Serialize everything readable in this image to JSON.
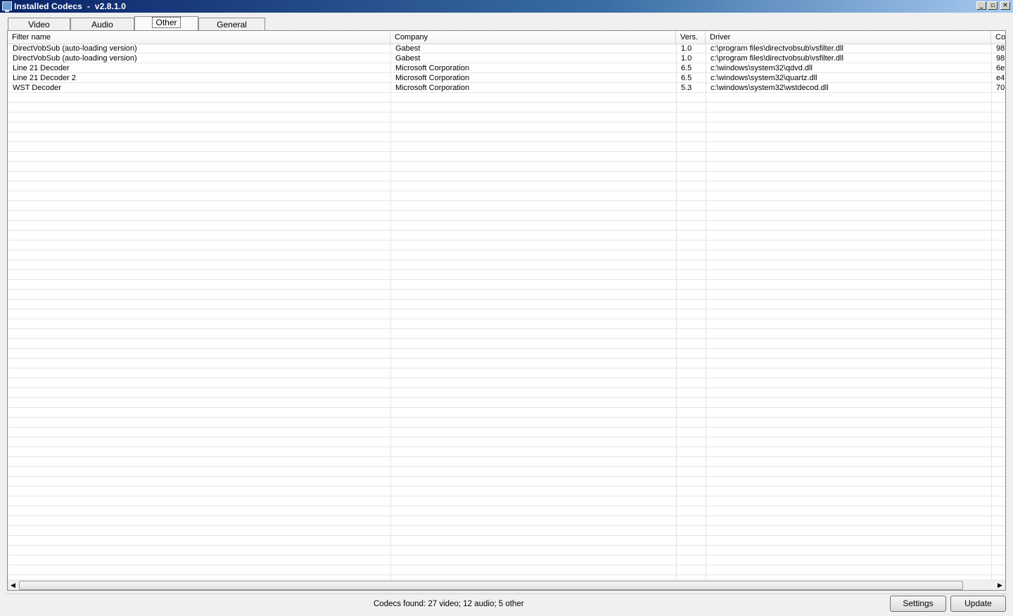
{
  "window": {
    "title": "Installed Codecs  -  v2.8.1.0",
    "minimize": "_",
    "maximize": "▫",
    "close": "✕"
  },
  "tabs": [
    {
      "label": "Video"
    },
    {
      "label": "Audio"
    },
    {
      "label": "Other"
    },
    {
      "label": "General"
    }
  ],
  "active_tab": "Other",
  "table": {
    "columns": [
      "Filter name",
      "Company",
      "Vers.",
      "Driver",
      "Co"
    ],
    "rows": [
      [
        "DirectVobSub (auto-loading version)",
        "Gabest",
        "1.0",
        "c:\\program files\\directvobsub\\vsfilter.dll",
        "98"
      ],
      [
        "DirectVobSub (auto-loading version)",
        "Gabest",
        "1.0",
        "c:\\program files\\directvobsub\\vsfilter.dll",
        "98"
      ],
      [
        "Line 21 Decoder",
        "Microsoft Corporation",
        "6.5",
        "c:\\windows\\system32\\qdvd.dll",
        "6e"
      ],
      [
        "Line 21 Decoder 2",
        "Microsoft Corporation",
        "6.5",
        "c:\\windows\\system32\\quartz.dll",
        "e4"
      ],
      [
        "WST Decoder",
        "Microsoft Corporation",
        "5.3",
        "c:\\windows\\system32\\wstdecod.dll",
        "70"
      ]
    ]
  },
  "scrollbar": {
    "left_arrow": "◀",
    "right_arrow": "▶"
  },
  "status": {
    "text": "Codecs found: 27 video; 12 audio; 5 other",
    "settings_label": "Settings",
    "update_label": "Update"
  }
}
